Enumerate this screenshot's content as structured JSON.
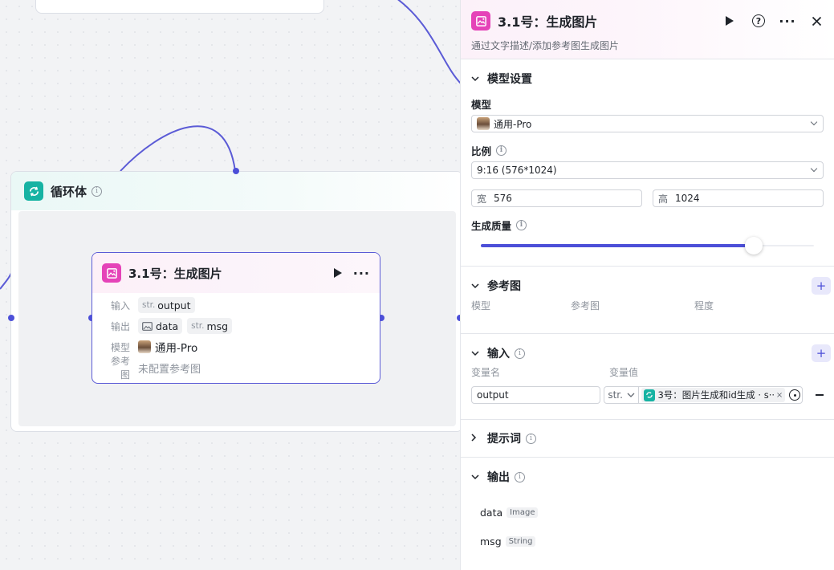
{
  "canvas": {
    "loop_node": {
      "title": "循环体"
    },
    "image_node": {
      "title": "3.1号：生成图片",
      "rows": {
        "input_key": "输入",
        "input_prefix": "str.",
        "input_value": "output",
        "output_key": "输出",
        "output_data": "data",
        "output_msg_prefix": "str.",
        "output_msg": "msg",
        "model_key": "模型",
        "model_value": "通用-Pro",
        "ref_key": "参考图",
        "ref_value": "未配置参考图"
      }
    }
  },
  "panel": {
    "title": "3.1号：生成图片",
    "description": "通过文字描述/添加参考图生成图片",
    "model_settings": {
      "title": "模型设置",
      "model_label": "模型",
      "model_value": "通用-Pro",
      "ratio_label": "比例",
      "ratio_value": "9:16 (576*1024)",
      "width_label": "宽",
      "width_value": "576",
      "height_label": "高",
      "height_value": "1024",
      "quality_label": "生成质量",
      "quality_level": 0.82
    },
    "reference": {
      "title": "参考图",
      "col_model": "模型",
      "col_ref": "参考图",
      "col_degree": "程度"
    },
    "inputs": {
      "title": "输入",
      "col_name": "变量名",
      "col_value": "变量值",
      "var_name": "output",
      "var_type": "str.",
      "var_ref": "3号：图片生成和id生成 · s···"
    },
    "prompt": {
      "title": "提示词"
    },
    "outputs": {
      "title": "输出",
      "items": [
        {
          "name": "data",
          "type": "Image"
        },
        {
          "name": "msg",
          "type": "String"
        }
      ]
    }
  },
  "colors": {
    "accent": "#4c4fd8",
    "teal": "#16b3a3",
    "pink": "#e543b8"
  }
}
